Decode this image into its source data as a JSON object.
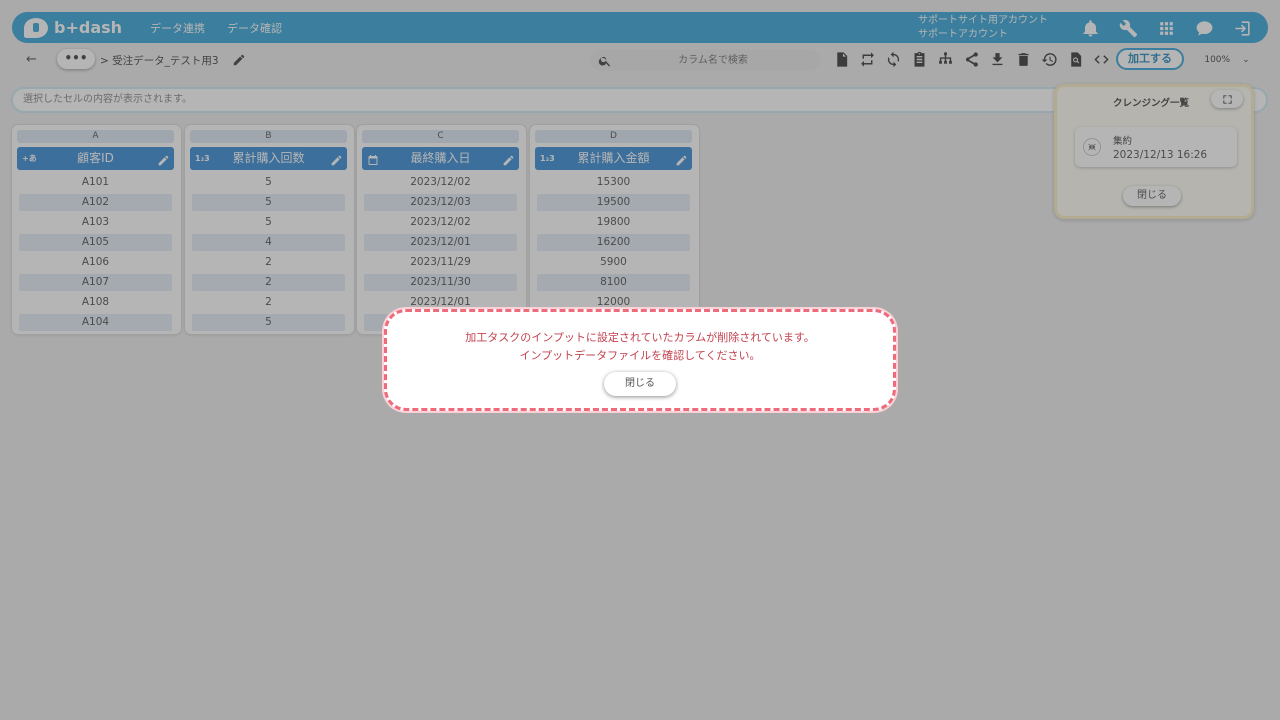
{
  "header": {
    "logo_text": "b+dash",
    "nav": [
      "データ連携",
      "データ確認"
    ],
    "account_line1": "サポートサイト用アカウント",
    "account_line2": "サポートアカウント",
    "icons": [
      "bell-icon",
      "wrench-icon",
      "apps-grid-icon",
      "chat-icon",
      "logout-icon"
    ]
  },
  "toolbar": {
    "back_glyph": "←",
    "more_label": "•••",
    "breadcrumb": "> 受注データ_テスト用3",
    "search_placeholder": "カラム名で検索",
    "process_label": "加工する",
    "zoom": "100%",
    "tool_icons": [
      "file-settings-icon",
      "repeat-icon",
      "sync-icon",
      "clipboard-icon",
      "hierarchy-icon",
      "share-icon",
      "download-icon",
      "trash-icon",
      "history-icon",
      "file-search-icon",
      "code-icon"
    ]
  },
  "cellbar": {
    "placeholder": "選択したセルの内容が表示されます。"
  },
  "columns": [
    {
      "letter": "A",
      "type": "+あ",
      "name": "顧客ID",
      "cells": [
        "A101",
        "A102",
        "A103",
        "A105",
        "A106",
        "A107",
        "A108",
        "A104"
      ]
    },
    {
      "letter": "B",
      "type": "1₂3",
      "name": "累計購入回数",
      "cells": [
        "5",
        "5",
        "5",
        "4",
        "2",
        "2",
        "2",
        "5"
      ]
    },
    {
      "letter": "C",
      "type": "cal",
      "name": "最終購入日",
      "cells": [
        "2023/12/02",
        "2023/12/03",
        "2023/12/02",
        "2023/12/01",
        "2023/11/29",
        "2023/11/30",
        "2023/12/01",
        ""
      ]
    },
    {
      "letter": "D",
      "type": "1₂3",
      "name": "累計購入金額",
      "cells": [
        "15300",
        "19500",
        "19800",
        "16200",
        "5900",
        "8100",
        "12000",
        ""
      ]
    }
  ],
  "cleansing_panel": {
    "title": "クレンジング一覧",
    "task_name": "集約",
    "task_time": "2023/12/13 16:26",
    "close_label": "閉じる"
  },
  "dialog": {
    "message_line1": "加工タスクのインプットに設定されていたカラムが削除されています。",
    "message_line2": "インプットデータファイルを確認してください。",
    "close_label": "閉じる"
  },
  "colors": {
    "header": "#3aa6d8",
    "column_header": "#3d8ed6",
    "dialog_border": "#ef6b7b",
    "dialog_text": "#c2424f"
  }
}
